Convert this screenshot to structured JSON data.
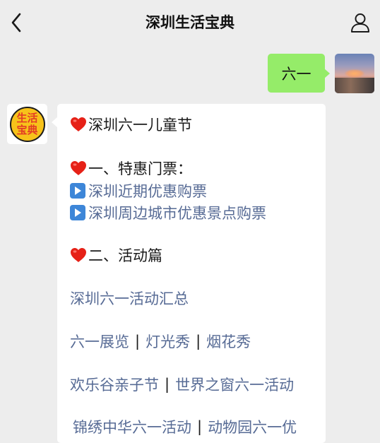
{
  "header": {
    "title": "深圳生活宝典"
  },
  "icons": {
    "back": "chevron-left-icon",
    "profile": "person-icon",
    "heart": "red-heart-icon",
    "play": "play-button-icon"
  },
  "colors": {
    "background": "#ededed",
    "outgoing_bubble": "#95ec69",
    "link": "#576b95",
    "heart": "#e62117",
    "play_button": "#3d86d8"
  },
  "outgoing": {
    "text": "六一"
  },
  "bot": {
    "avatar_text_1": "生活",
    "avatar_text_2": "宝典"
  },
  "message": {
    "title": "深圳六一儿童节",
    "section1": "一、特惠门票：",
    "link1": "深圳近期优惠购票",
    "link2": "深圳周边城市优惠景点购票",
    "section2": "二、活动篇",
    "link3": "深圳六一活动汇总",
    "row1": [
      "六一展览",
      "灯光秀",
      "烟花秀"
    ],
    "row2": [
      "欢乐谷亲子节",
      "世界之窗六一活动"
    ],
    "row3": [
      "锦绣中华六一活动",
      "动物园六一优"
    ],
    "separator": "|"
  }
}
